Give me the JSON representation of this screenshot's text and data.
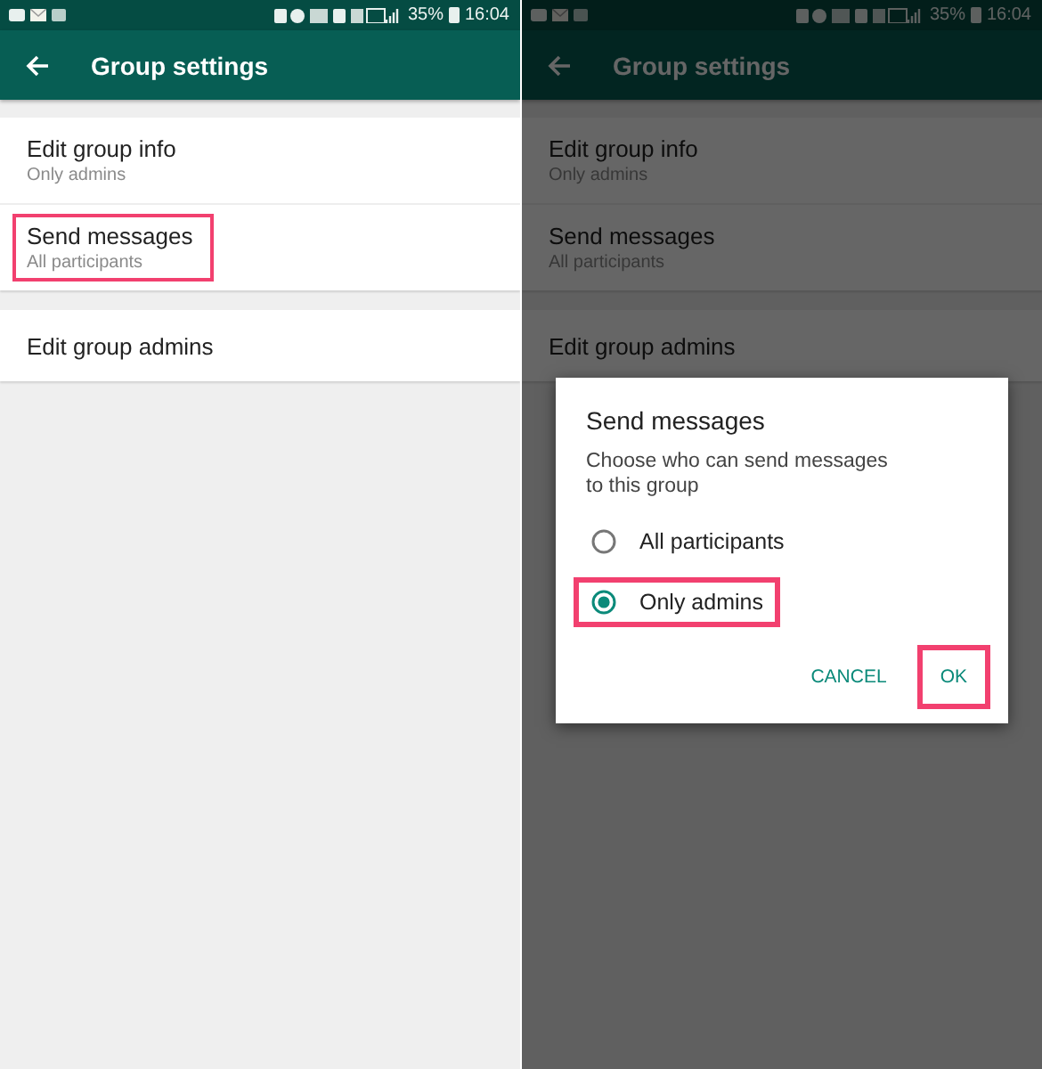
{
  "screens": [
    {
      "status_bar": {
        "battery": "35%",
        "time": "16:04"
      },
      "app_bar": {
        "title": "Group settings"
      },
      "dimmed": false,
      "sections": [
        {
          "items": [
            {
              "title": "Edit group info",
              "subtitle": "Only admins",
              "highlighted": false
            },
            {
              "title": "Send messages",
              "subtitle": "All participants",
              "highlighted": true
            }
          ]
        },
        {
          "items": [
            {
              "title": "Edit group admins",
              "highlighted": false
            }
          ]
        }
      ]
    },
    {
      "status_bar": {
        "battery": "35%",
        "time": "16:04"
      },
      "app_bar": {
        "title": "Group settings"
      },
      "dimmed": true,
      "sections": [
        {
          "items": [
            {
              "title": "Edit group info",
              "subtitle": "Only admins",
              "highlighted": false
            },
            {
              "title": "Send messages",
              "subtitle": "All participants",
              "highlighted": false
            }
          ]
        },
        {
          "items": [
            {
              "title": "Edit group admins",
              "highlighted": false
            }
          ]
        }
      ],
      "dialog": {
        "title": "Send messages",
        "message": "Choose who can send messages to this group",
        "options": [
          {
            "label": "All participants",
            "selected": false,
            "highlighted": false
          },
          {
            "label": "Only admins",
            "selected": true,
            "highlighted": true
          }
        ],
        "buttons": [
          {
            "label": "CANCEL",
            "highlighted": false
          },
          {
            "label": "OK",
            "highlighted": true
          }
        ]
      }
    }
  ]
}
